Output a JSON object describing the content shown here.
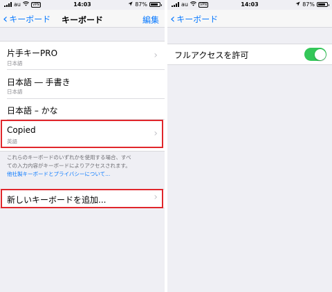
{
  "status_left": {
    "carrier": "au",
    "time": "14:03",
    "vpn": "VPN",
    "battery": "87%"
  },
  "status_right": {
    "carrier": "au",
    "time": "14:03",
    "vpn": "VPN",
    "battery": "87%"
  },
  "battery_level": 0.87,
  "left_nav": {
    "back": "キーボード",
    "title": "キーボード",
    "edit": "編集"
  },
  "keyboards": [
    {
      "name": "片手キーPRO",
      "sub": "日本語"
    },
    {
      "name": "日本語 ― 手書き",
      "sub": "日本語"
    },
    {
      "name": "日本語 – かな",
      "sub": ""
    },
    {
      "name": "Copied",
      "sub": "英語"
    }
  ],
  "footnote": {
    "line1": "これらのキーボードのいずれかを使用する場合、すべ",
    "line2": "ての入力内容がキーボードによりアクセスされます。",
    "link": "他社製キーボードとプライバシーについて..."
  },
  "add_keyboard": "新しいキーボードを追加...",
  "right_nav": {
    "back": "キーボード"
  },
  "full_access": {
    "label": "フルアクセスを許可",
    "enabled": true
  },
  "colors": {
    "accent": "#0a7aff",
    "toggle_on": "#34c759",
    "highlight": "#e0262b",
    "background": "#efeff4"
  }
}
